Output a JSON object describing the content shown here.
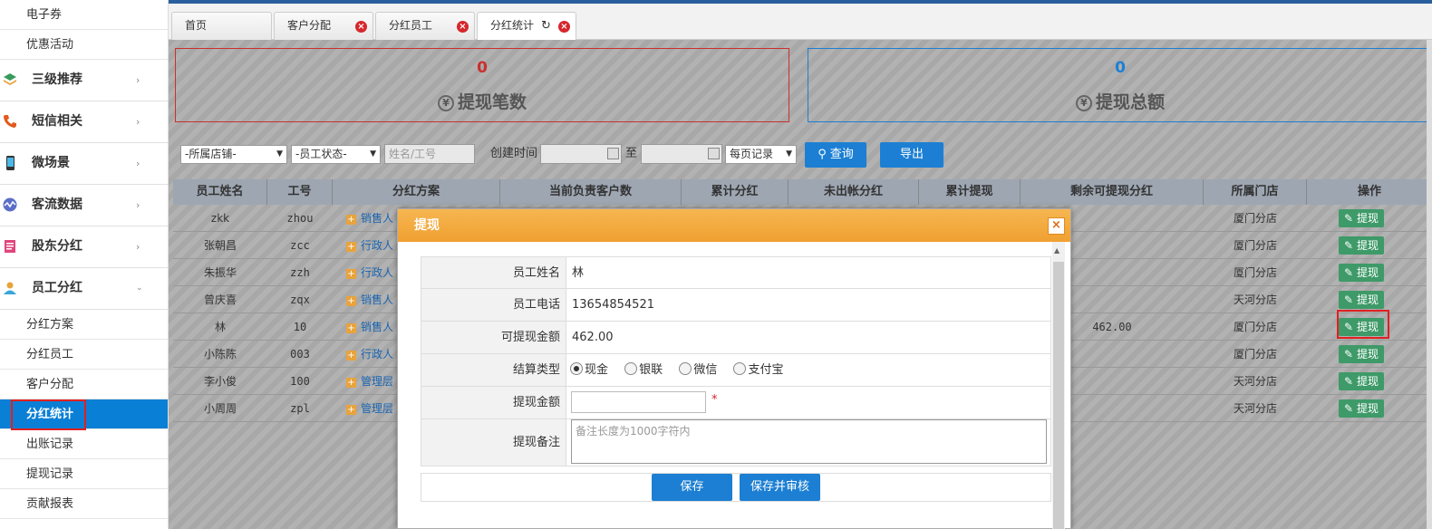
{
  "sidebar": {
    "top_items": [
      "电子券",
      "优惠活动"
    ],
    "menus": [
      {
        "label": "三级推荐",
        "icon": "layers-icon"
      },
      {
        "label": "短信相关",
        "icon": "phone-icon"
      },
      {
        "label": "微场景",
        "icon": "mobile-icon"
      },
      {
        "label": "客流数据",
        "icon": "chart-icon"
      },
      {
        "label": "股东分红",
        "icon": "document-icon"
      },
      {
        "label": "员工分红",
        "icon": "user-icon"
      }
    ],
    "sub_items": [
      "分红方案",
      "分红员工",
      "客户分配",
      "分红统计",
      "出账记录",
      "提现记录",
      "贡献报表"
    ],
    "active_sub": "分红统计"
  },
  "tabs": [
    {
      "label": "首页"
    },
    {
      "label": "客户分配"
    },
    {
      "label": "分红员工"
    },
    {
      "label": "分红统计"
    }
  ],
  "stats": {
    "count": {
      "value": "0",
      "label": "提现笔数",
      "color": "#c9302c"
    },
    "total": {
      "value": "0",
      "label": "提现总额",
      "color": "#1c7fd3"
    }
  },
  "filter": {
    "store": "-所属店铺-",
    "status": "-员工状态-",
    "name_placeholder": "姓名/工号",
    "created_label": "创建时间",
    "to_label": "至",
    "per_page": "每页记录",
    "query_label": "查询",
    "export_label": "导出"
  },
  "table": {
    "headers": [
      "员工姓名",
      "工号",
      "分红方案",
      "当前负责客户数",
      "累计分红",
      "未出帐分红",
      "累计提现",
      "剩余可提现分红",
      "所属门店",
      "操作"
    ],
    "rows": [
      {
        "name": "zkk",
        "id": "zhou",
        "plan": "销售人",
        "remaining": "",
        "store": "厦门分店"
      },
      {
        "name": "张朝昌",
        "id": "zcc",
        "plan": "行政人",
        "remaining": "",
        "store": "厦门分店"
      },
      {
        "name": "朱振华",
        "id": "zzh",
        "plan": "行政人",
        "remaining": "",
        "store": "厦门分店"
      },
      {
        "name": "曾庆喜",
        "id": "zqx",
        "plan": "销售人",
        "remaining": "",
        "store": "天河分店"
      },
      {
        "name": "林",
        "id": "10",
        "plan": "销售人",
        "remaining": "462.00",
        "store": "厦门分店"
      },
      {
        "name": "小陈陈",
        "id": "003",
        "plan": "行政人",
        "remaining": "",
        "store": "厦门分店"
      },
      {
        "name": "李小俊",
        "id": "100",
        "plan": "管理层",
        "remaining": "",
        "store": "天河分店"
      },
      {
        "name": "小周周",
        "id": "zpl",
        "plan": "管理层",
        "remaining": "",
        "store": "天河分店"
      }
    ],
    "action_label": "提现"
  },
  "modal": {
    "title": "提现",
    "close": "×",
    "fields": {
      "name_label": "员工姓名",
      "name_value": "林",
      "phone_label": "员工电话",
      "phone_value": "13654854521",
      "amount_label": "可提现金额",
      "amount_value": "462.00",
      "type_label": "结算类型",
      "withdraw_label": "提现金额",
      "remark_label": "提现备注",
      "remark_placeholder": "备注长度为1000字符内"
    },
    "types": [
      "现金",
      "银联",
      "微信",
      "支付宝"
    ],
    "required_mark": "*",
    "save": "保存",
    "save_audit": "保存并审核"
  }
}
